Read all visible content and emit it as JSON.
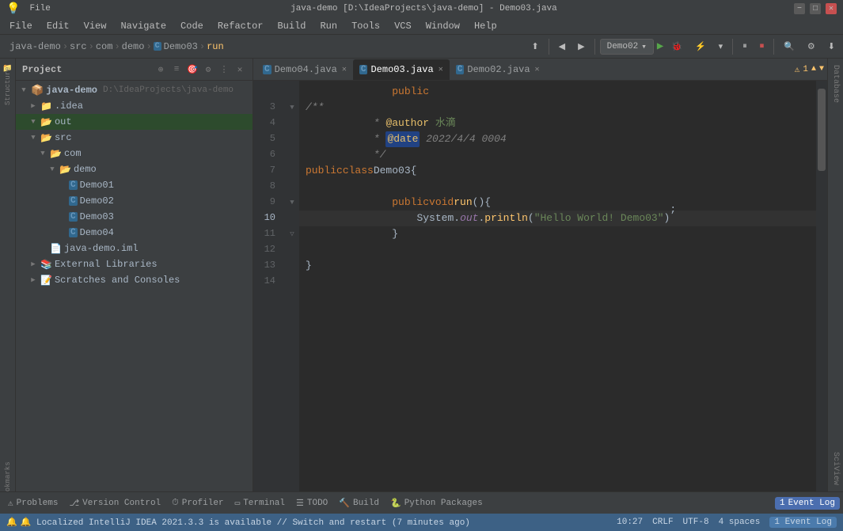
{
  "titleBar": {
    "title": "java-demo [D:\\IdeaProjects\\java-demo] - Demo03.java",
    "appName": "IntelliJ IDEA",
    "minimize": "−",
    "maximize": "□",
    "close": "✕"
  },
  "menuBar": {
    "items": [
      "File",
      "Edit",
      "View",
      "Navigate",
      "Code",
      "Refactor",
      "Build",
      "Run",
      "Tools",
      "VCS",
      "Window",
      "Help"
    ]
  },
  "toolbar": {
    "breadcrumbs": [
      "java-demo",
      "src",
      "com",
      "demo",
      "Demo03",
      "run"
    ],
    "runConfig": "Demo02",
    "separators": [
      "›",
      "›",
      "›",
      "›",
      "›"
    ]
  },
  "sidebar": {
    "title": "Project",
    "tree": [
      {
        "indent": 0,
        "type": "root",
        "label": "java-demo",
        "path": "D:\\IdeaProjects\\java-demo",
        "icon": "project",
        "arrow": "▼"
      },
      {
        "indent": 1,
        "type": "folder",
        "label": ".idea",
        "icon": "folder",
        "arrow": "▶"
      },
      {
        "indent": 1,
        "type": "folder-open",
        "label": "out",
        "icon": "folder",
        "arrow": "▼",
        "selected": true
      },
      {
        "indent": 1,
        "type": "folder-open",
        "label": "src",
        "icon": "src",
        "arrow": "▼"
      },
      {
        "indent": 2,
        "type": "folder-open",
        "label": "com",
        "icon": "folder",
        "arrow": "▼"
      },
      {
        "indent": 3,
        "type": "folder-open",
        "label": "demo",
        "icon": "folder",
        "arrow": "▼"
      },
      {
        "indent": 4,
        "type": "class",
        "label": "Demo01",
        "icon": "C"
      },
      {
        "indent": 4,
        "type": "class",
        "label": "Demo02",
        "icon": "C"
      },
      {
        "indent": 4,
        "type": "class",
        "label": "Demo03",
        "icon": "C"
      },
      {
        "indent": 4,
        "type": "class",
        "label": "Demo04",
        "icon": "C"
      },
      {
        "indent": 2,
        "type": "iml",
        "label": "java-demo.iml",
        "icon": "iml"
      },
      {
        "indent": 1,
        "type": "folder",
        "label": "External Libraries",
        "icon": "extlib",
        "arrow": "▶"
      },
      {
        "indent": 1,
        "type": "folder",
        "label": "Scratches and Consoles",
        "icon": "scratch",
        "arrow": "▶"
      }
    ]
  },
  "editorTabs": [
    {
      "id": "demo04",
      "label": "Demo04.java",
      "icon": "C",
      "active": false,
      "modified": false
    },
    {
      "id": "demo03",
      "label": "Demo03.java",
      "icon": "C",
      "active": true,
      "modified": false
    },
    {
      "id": "demo02",
      "label": "Demo02.java",
      "icon": "C",
      "active": false,
      "modified": false
    }
  ],
  "warningCount": "1",
  "codeLines": [
    {
      "num": "",
      "fold": "",
      "content": "    public"
    },
    {
      "num": "3",
      "fold": "▼",
      "content": "/**"
    },
    {
      "num": "4",
      "fold": "",
      "content": " * @author 水滴"
    },
    {
      "num": "5",
      "fold": "",
      "content": " * @date 2022/4/4 0004"
    },
    {
      "num": "6",
      "fold": "",
      "content": " */"
    },
    {
      "num": "7",
      "fold": "",
      "content": "public class Demo03 {"
    },
    {
      "num": "8",
      "fold": "",
      "content": ""
    },
    {
      "num": "9",
      "fold": "▼",
      "content": "    public void run() {"
    },
    {
      "num": "10",
      "fold": "",
      "content": "        System.out.println(\"Hello World! Demo03\");"
    },
    {
      "num": "11",
      "fold": "▽",
      "content": "    }"
    },
    {
      "num": "12",
      "fold": "",
      "content": ""
    },
    {
      "num": "13",
      "fold": "",
      "content": "}"
    },
    {
      "num": "14",
      "fold": "",
      "content": ""
    }
  ],
  "bottomBar": {
    "items": [
      {
        "icon": "⚠",
        "label": "Problems"
      },
      {
        "icon": "⎇",
        "label": "Version Control"
      },
      {
        "icon": "⏱",
        "label": "Profiler"
      },
      {
        "icon": "▭",
        "label": "Terminal"
      },
      {
        "icon": "☰",
        "label": "TODO"
      },
      {
        "icon": "🔨",
        "label": "Build"
      },
      {
        "icon": "🐍",
        "label": "Python Packages"
      }
    ]
  },
  "statusBar": {
    "message": "🔔 Localized IntelliJ IDEA 2021.3.3 is available // Switch and restart (7 minutes ago)",
    "line": "10:27",
    "lineEnding": "CRLF",
    "encoding": "UTF-8",
    "indent": "4 spaces",
    "eventLog": "1 Event Log"
  },
  "rightPanel": {
    "labels": [
      "Database",
      "SciView"
    ]
  }
}
